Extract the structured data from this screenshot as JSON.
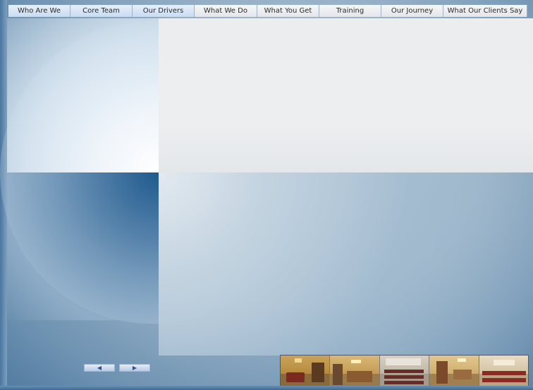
{
  "nav": {
    "items": [
      {
        "label": "Who Are We",
        "active": true
      },
      {
        "label": "Core Team",
        "active": true
      },
      {
        "label": "Our Drivers",
        "active": true
      },
      {
        "label": "What We Do",
        "active": false
      },
      {
        "label": "What You Get",
        "active": false
      },
      {
        "label": "Training",
        "active": false
      },
      {
        "label": "Our Journey",
        "active": false
      },
      {
        "label": "What Our Clients Say",
        "active": false
      }
    ]
  },
  "gallery": {
    "prev_icon": "◀",
    "next_icon": "▶",
    "thumbnails": [
      {
        "name": "lounge-photo"
      },
      {
        "name": "reception-photo"
      },
      {
        "name": "classroom-photo"
      },
      {
        "name": "office-photo"
      },
      {
        "name": "training-room-photo"
      }
    ]
  },
  "colors": {
    "background": "#9cb4c9",
    "panel_light": "#eceef0",
    "accent_dark": "#1f5a8e",
    "nav_active": "#c8dcf0"
  }
}
